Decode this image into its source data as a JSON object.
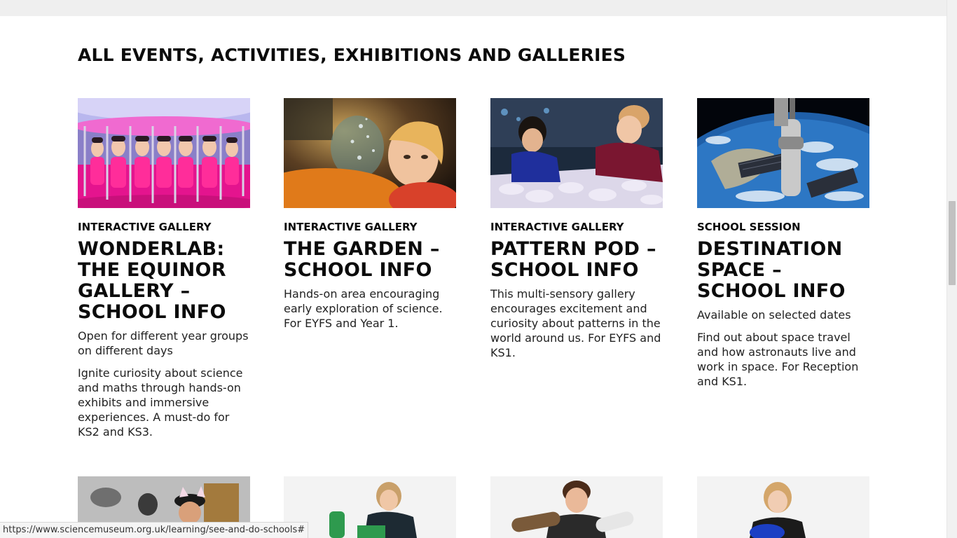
{
  "section": {
    "title": "ALL EVENTS, ACTIVITIES, EXHIBITIONS AND GALLERIES"
  },
  "cards": [
    {
      "category": "INTERACTIVE GALLERY",
      "title": "WONDERLAB: THE EQUINOR GALLERY – SCHOOL INFO",
      "text1": "Open for different year groups on different days",
      "text2": "Ignite curiosity about science and maths through hands-on exhibits and immersive experiences. A must-do for KS2 and KS3."
    },
    {
      "category": "INTERACTIVE GALLERY",
      "title": "THE GARDEN – SCHOOL INFO",
      "text1": "Hands-on area encouraging early exploration of science. For EYFS and Year 1."
    },
    {
      "category": "INTERACTIVE GALLERY",
      "title": "PATTERN POD – SCHOOL INFO",
      "text1": "This multi-sensory gallery encourages excitement and curiosity about patterns in the world around us. For EYFS and KS1."
    },
    {
      "category": "SCHOOL SESSION",
      "title": "DESTINATION SPACE – SCHOOL INFO",
      "text1": "Available on selected dates",
      "text2": "Find out about space travel and how astronauts live and work in space. For Reception and KS1."
    }
  ],
  "status_url": "https://www.sciencemuseum.org.uk/learning/see-and-do-schools#"
}
